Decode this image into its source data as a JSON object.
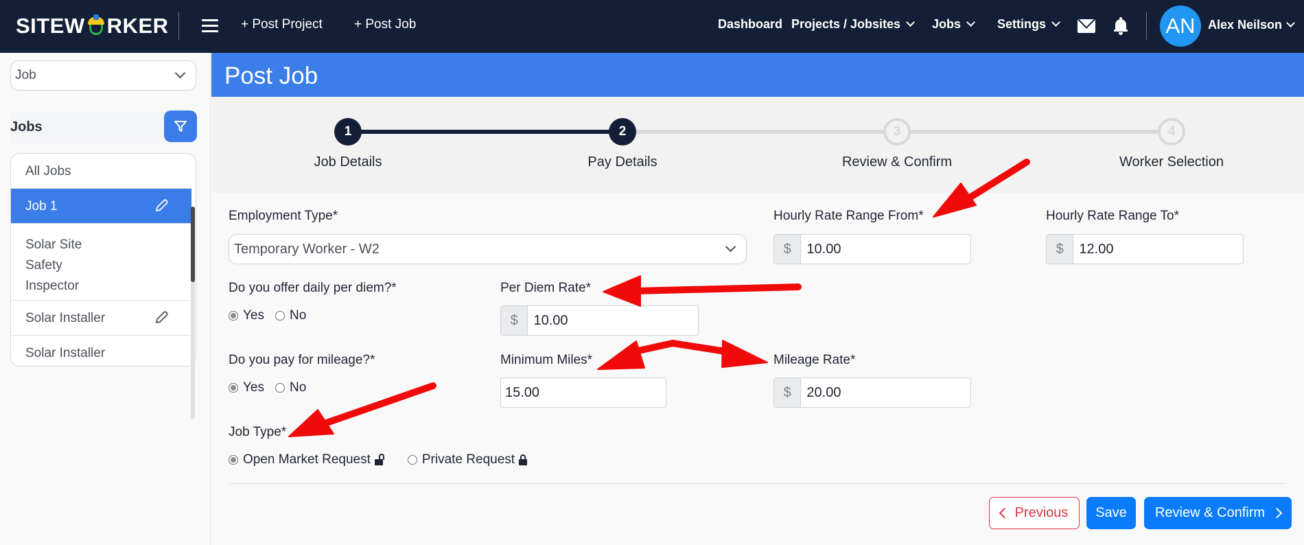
{
  "nav": {
    "brand": "SITEWORKER",
    "brand_prefix": "SITEW",
    "brand_suffix": "RKER",
    "post_project": "+ Post Project",
    "post_job": "+ Post Job",
    "dashboard": "Dashboard",
    "projects": "Projects / Jobsites",
    "jobs": "Jobs",
    "settings": "Settings",
    "avatar_initials": "AN",
    "user_name": "Alex Neilson",
    "icons": [
      "hamburger-icon",
      "mail-icon",
      "bell-icon"
    ]
  },
  "sidebar": {
    "select_value": "Job",
    "jobs_title": "Jobs",
    "items": [
      {
        "label": "All Jobs",
        "active": false,
        "editable": false
      },
      {
        "label": "Job 1",
        "active": true,
        "editable": true
      },
      {
        "label": "Solar Site Safety Inspector",
        "lines": [
          "Solar Site",
          "Safety",
          "Inspector"
        ],
        "active": false,
        "editable": false
      },
      {
        "label": "Solar Installer",
        "active": false,
        "editable": true
      },
      {
        "label": "Solar Installer",
        "active": false,
        "editable": false
      }
    ]
  },
  "page": {
    "title": "Post Job"
  },
  "stepper": {
    "current_step": 2,
    "steps": [
      {
        "number": "1",
        "label": "Job Details",
        "status": "complete"
      },
      {
        "number": "2",
        "label": "Pay Details",
        "status": "current"
      },
      {
        "number": "3",
        "label": "Review & Confirm",
        "status": "pending"
      },
      {
        "number": "4",
        "label": "Worker Selection",
        "status": "pending"
      }
    ]
  },
  "form": {
    "employment_type": {
      "label": "Employment Type*",
      "value": "Temporary Worker - W2"
    },
    "hourly_from": {
      "label": "Hourly Rate Range From*",
      "prefix": "$",
      "value": "10.00"
    },
    "hourly_to": {
      "label": "Hourly Rate Range To*",
      "prefix": "$",
      "value": "12.00"
    },
    "per_diem_question": {
      "label": "Do you offer daily per diem?*",
      "options": [
        "Yes",
        "No"
      ],
      "selected": "Yes"
    },
    "per_diem_rate": {
      "label": "Per Diem Rate*",
      "prefix": "$",
      "value": "10.00"
    },
    "mileage_question": {
      "label": "Do you pay for mileage?*",
      "options": [
        "Yes",
        "No"
      ],
      "selected": "Yes"
    },
    "minimum_miles": {
      "label": "Minimum Miles*",
      "value": "15.00"
    },
    "mileage_rate": {
      "label": "Mileage Rate*",
      "prefix": "$",
      "value": "20.00"
    },
    "job_type": {
      "label": "Job Type*",
      "options": [
        "Open Market Request",
        "Private Request"
      ],
      "selected": "Open Market Request"
    }
  },
  "actions": {
    "previous": "Previous",
    "save": "Save",
    "review_confirm": "Review & Confirm"
  },
  "annotation_color": "#f00a0a"
}
